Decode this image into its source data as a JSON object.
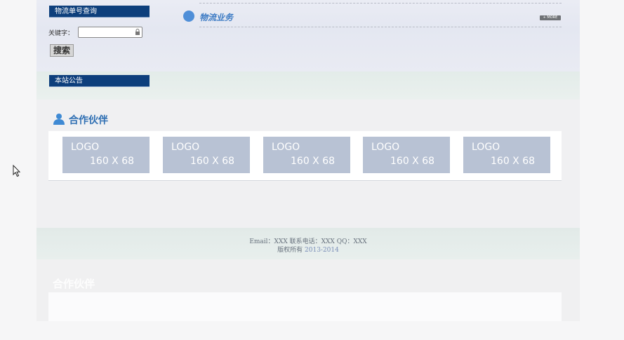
{
  "logistics_query": {
    "header": "物流单号查询",
    "keyword_label": "关键字：",
    "keyword_value": "",
    "search_button": "搜索"
  },
  "logistics_business": {
    "title": "物流业务",
    "more_label": "+ MORE"
  },
  "notice": {
    "header": "本站公告"
  },
  "partners": {
    "title": "合作伙伴",
    "logos": [
      {
        "line1": "LOGO",
        "line2": "160 X 68"
      },
      {
        "line1": "LOGO",
        "line2": "160 X 68"
      },
      {
        "line1": "LOGO",
        "line2": "160 X 68"
      },
      {
        "line1": "LOGO",
        "line2": "160 X 68"
      },
      {
        "line1": "LOGO",
        "line2": "160 X 68"
      }
    ]
  },
  "footer": {
    "contact": "Email：XXX 联系电话：XXX QQ：XXX",
    "copyright": "版权所有",
    "years": "2013-2014"
  },
  "colors": {
    "header_blue": "#0d3f7c",
    "title_blue": "#2f6fb3",
    "logo_tile": "#b8c2d4"
  }
}
